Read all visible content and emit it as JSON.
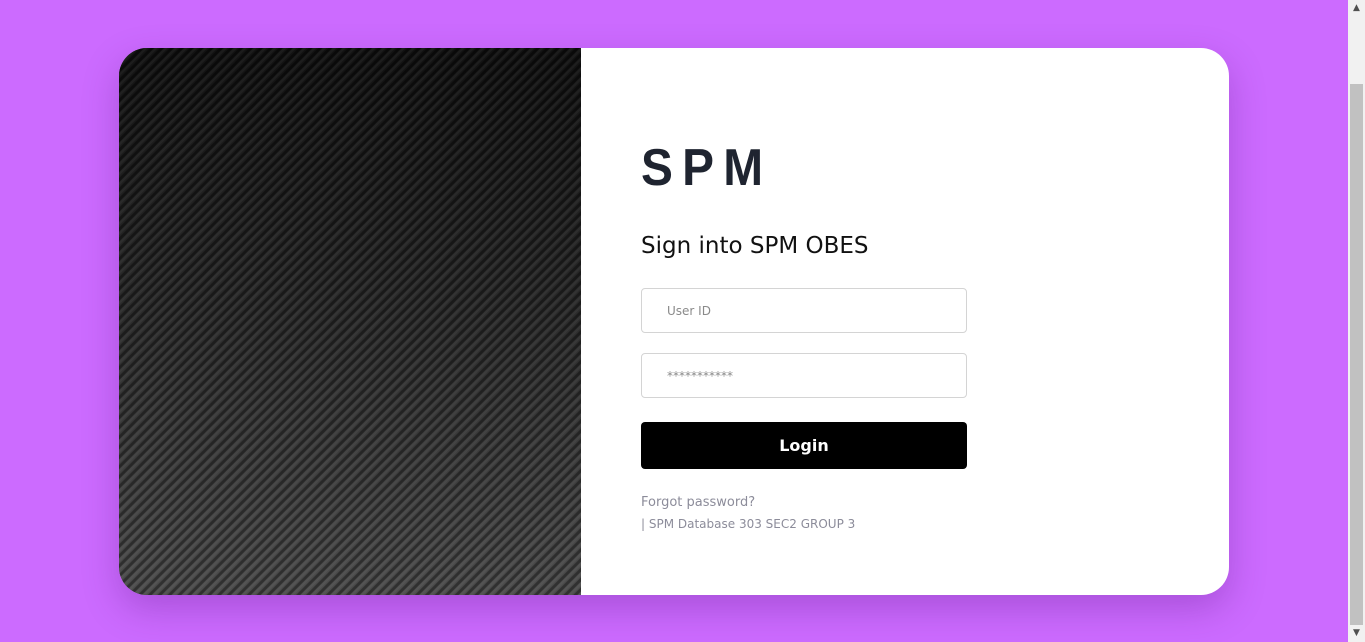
{
  "brand": {
    "logo_text": "SPM"
  },
  "login": {
    "heading": "Sign into SPM OBES",
    "user_id_placeholder": "User ID",
    "password_placeholder": "***********",
    "login_label": "Login",
    "forgot_label": "Forgot password?",
    "footer_text": "| SPM Database 303 SEC2 GROUP 3"
  },
  "scrollbar": {
    "up_icon": "▲",
    "down_icon": "▼"
  },
  "colors": {
    "page_background": "#cc6bff",
    "card_background": "#ffffff",
    "button_background": "#000000",
    "muted_text": "#8c8c9a"
  }
}
